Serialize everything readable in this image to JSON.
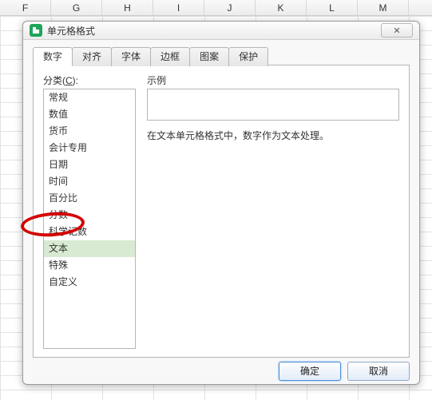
{
  "columns": [
    "F",
    "G",
    "H",
    "I",
    "J",
    "K",
    "L",
    "M"
  ],
  "dialog": {
    "title": "单元格格式",
    "close_glyph": "✕",
    "tabs": [
      {
        "label": "数字"
      },
      {
        "label": "对齐"
      },
      {
        "label": "字体"
      },
      {
        "label": "边框"
      },
      {
        "label": "图案"
      },
      {
        "label": "保护"
      }
    ],
    "category_label_prefix": "分类(",
    "category_label_key": "C",
    "category_label_suffix": "):",
    "categories": [
      "常规",
      "数值",
      "货币",
      "会计专用",
      "日期",
      "时间",
      "百分比",
      "分数",
      "科学记数",
      "文本",
      "特殊",
      "自定义"
    ],
    "selected_category_index": 9,
    "sample_label": "示例",
    "description": "在文本单元格格式中，数字作为文本处理。",
    "ok_label": "确定",
    "cancel_label": "取消"
  }
}
